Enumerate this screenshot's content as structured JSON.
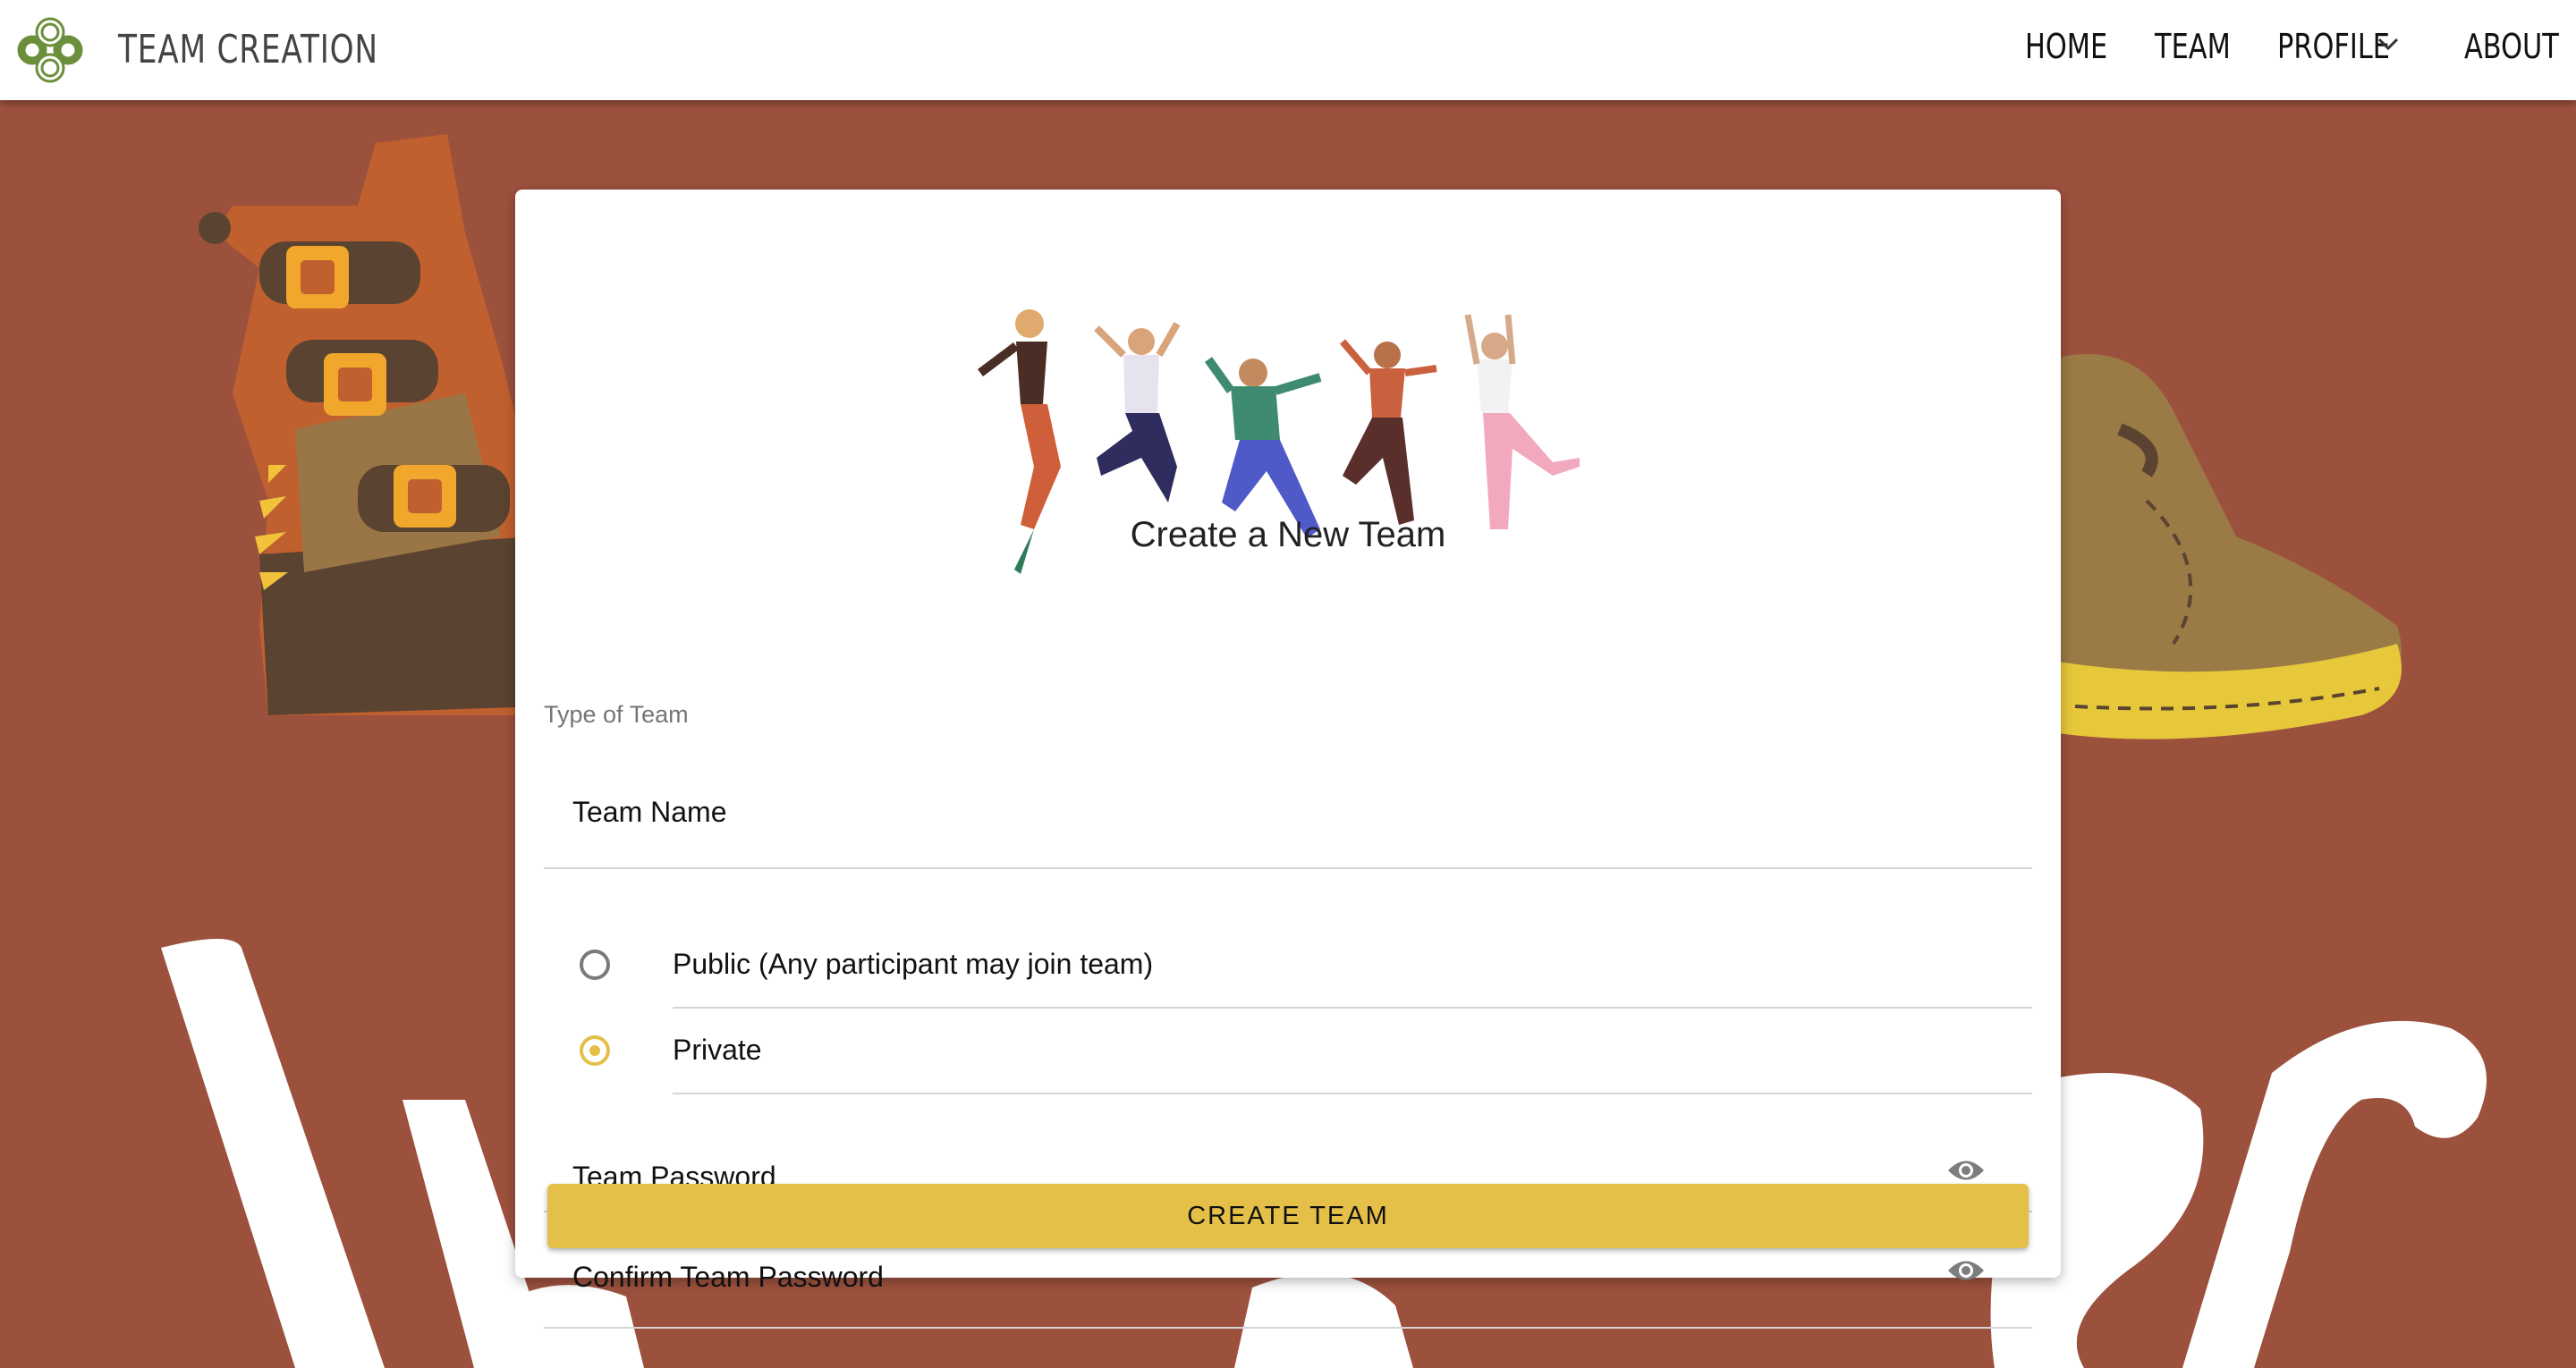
{
  "app": {
    "title": "TEAM CREATION"
  },
  "nav": {
    "home": "HOME",
    "team": "TEAM",
    "profile": "PROFILE",
    "about": "ABOUT"
  },
  "form": {
    "title": "Create a New Team",
    "team_name_label": "Team Name",
    "type_label": "Type of Team",
    "options": [
      {
        "label": "Public (Any participant may join team)",
        "selected": false
      },
      {
        "label": "Private",
        "selected": true
      }
    ],
    "password_label": "Team Password",
    "confirm_password_label": "Confirm Team Password",
    "submit_label": "CREATE TEAM"
  },
  "colors": {
    "background": "#9c513d",
    "accent": "#e5c048",
    "logo": "#6b8f3a"
  },
  "icons": [
    "logo-icon",
    "chevron-down-icon",
    "eye-icon"
  ]
}
